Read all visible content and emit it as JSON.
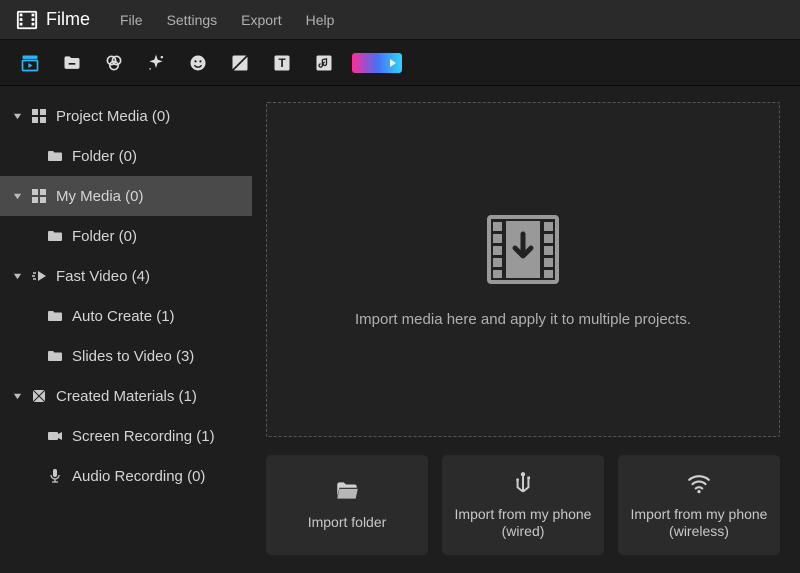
{
  "app": {
    "name": "Filme"
  },
  "menu": {
    "file": "File",
    "settings": "Settings",
    "export": "Export",
    "help": "Help"
  },
  "sidebar": {
    "project_media": "Project Media (0)",
    "project_folder": "Folder (0)",
    "my_media": "My Media (0)",
    "my_folder": "Folder (0)",
    "fast_video": "Fast Video (4)",
    "auto_create": "Auto Create (1)",
    "slides_to_video": "Slides to Video (3)",
    "created_materials": "Created Materials (1)",
    "screen_recording": "Screen Recording (1)",
    "audio_recording": "Audio Recording (0)"
  },
  "dropzone": {
    "text": "Import media here and apply it to multiple projects."
  },
  "import": {
    "folder": "Import folder",
    "wired": "Import from my phone (wired)",
    "wireless": "Import from my phone (wireless)"
  }
}
